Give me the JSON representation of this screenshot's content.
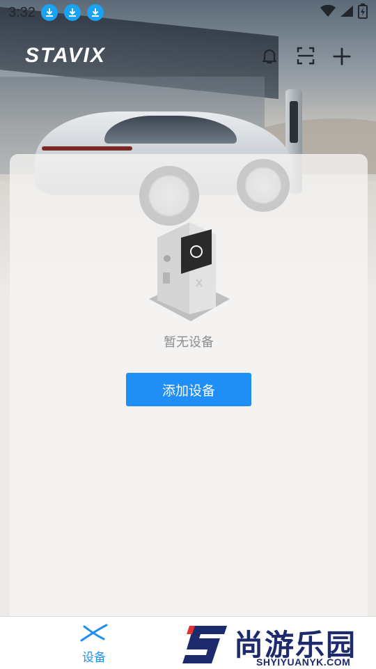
{
  "status_bar": {
    "time": "3:32",
    "notification_icons": [
      "download-icon",
      "download-icon",
      "download-icon"
    ],
    "right_icons": [
      "wifi-icon",
      "signal-icon",
      "battery-icon"
    ]
  },
  "header": {
    "logo_text": "STAVIX",
    "actions": [
      "bell-icon",
      "scan-icon",
      "plus-icon"
    ]
  },
  "main": {
    "empty_text": "暂无设备",
    "add_button_label": "添加设备"
  },
  "bottom_nav": {
    "items": [
      {
        "label": "设备",
        "icon": "stavix-x-icon",
        "active": true
      }
    ]
  },
  "watermark": {
    "title": "尚游乐园",
    "subtitle": "SHYIYUANYK.COM"
  },
  "colors": {
    "accent": "#1f8ff5",
    "download_badge": "#1aa3f2",
    "watermark": "#1d2a6b",
    "watermark_accent": "#e0322e"
  }
}
